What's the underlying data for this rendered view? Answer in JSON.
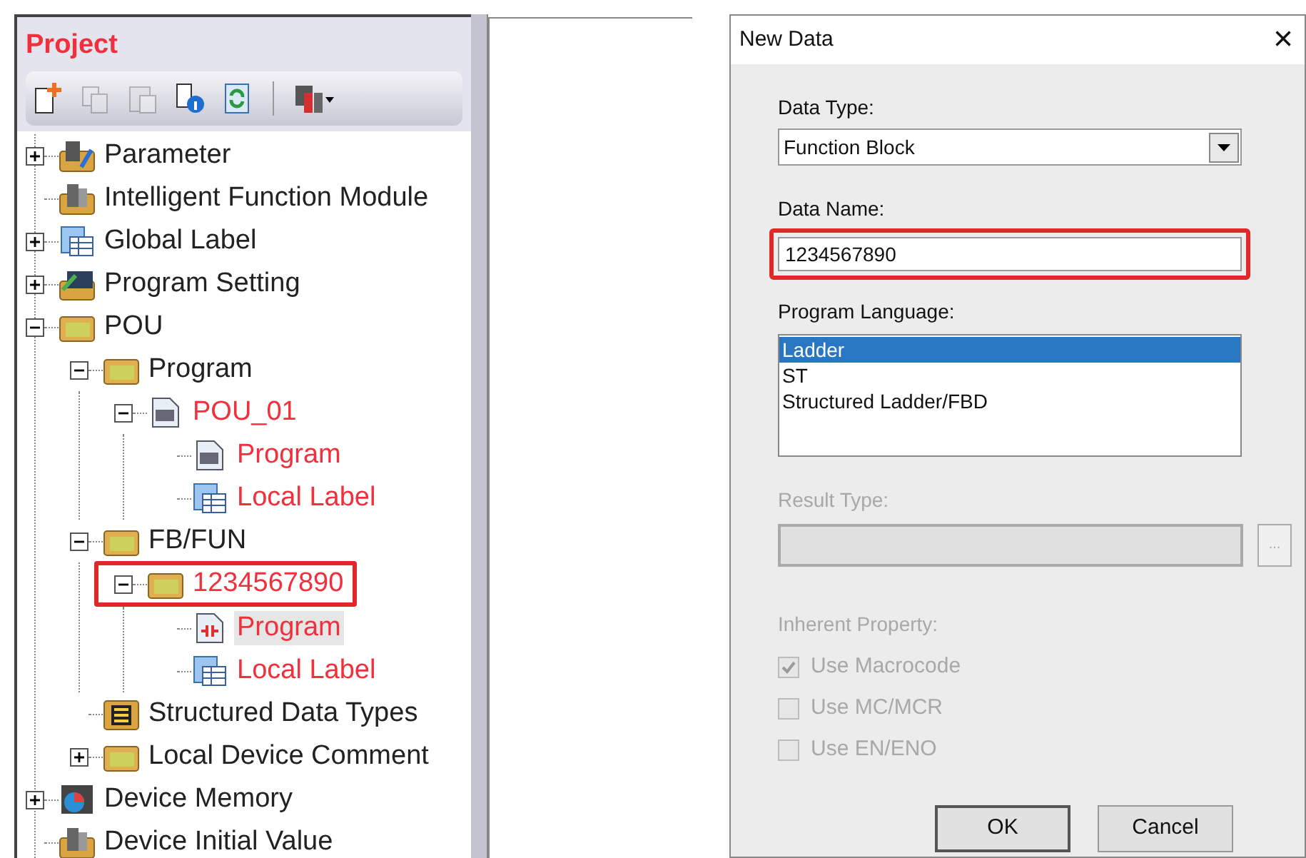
{
  "project_panel": {
    "title": "Project",
    "toolbar": [
      {
        "kind": "new",
        "disabled": false
      },
      {
        "kind": "copy",
        "disabled": true
      },
      {
        "kind": "paste",
        "disabled": true
      },
      {
        "kind": "info",
        "disabled": false
      },
      {
        "kind": "refresh",
        "disabled": false
      },
      {
        "kind": "separator"
      },
      {
        "kind": "device",
        "disabled": false
      }
    ],
    "tree": [
      {
        "label": "Parameter",
        "kind": "gear",
        "expanded": false,
        "modified": false
      },
      {
        "label": "Intelligent Function Module",
        "kind": "module",
        "modified": false
      },
      {
        "label": "Global Label",
        "kind": "table",
        "expanded": false,
        "modified": false
      },
      {
        "label": "Program Setting",
        "kind": "monitor",
        "expanded": false,
        "modified": false
      },
      {
        "label": "POU",
        "kind": "folder",
        "expanded": true,
        "modified": false,
        "children": [
          {
            "label": "Program",
            "kind": "folder",
            "expanded": true,
            "modified": false,
            "children": [
              {
                "label": "POU_01",
                "kind": "document",
                "expanded": true,
                "modified": true,
                "children": [
                  {
                    "label": "Program",
                    "kind": "document",
                    "modified": true,
                    "selected": false
                  },
                  {
                    "label": "Local Label",
                    "kind": "table",
                    "modified": true,
                    "selected": false
                  }
                ]
              }
            ]
          },
          {
            "label": "FB/FUN",
            "kind": "folder",
            "expanded": true,
            "modified": false,
            "children": [
              {
                "label": "1234567890",
                "kind": "folder",
                "expanded": true,
                "modified": true,
                "marked": true,
                "children": [
                  {
                    "label": "Program",
                    "kind": "ladder",
                    "modified": true,
                    "selected": true
                  },
                  {
                    "label": "Local Label",
                    "kind": "table",
                    "modified": true,
                    "selected": false
                  }
                ]
              }
            ]
          },
          {
            "label": "Structured Data Types",
            "kind": "struct",
            "modified": false
          },
          {
            "label": "Local Device Comment",
            "kind": "folder",
            "expanded": false,
            "modified": false
          }
        ]
      },
      {
        "label": "Device Memory",
        "kind": "chart",
        "expanded": false,
        "modified": false
      },
      {
        "label": "Device Initial Value",
        "kind": "module",
        "modified": false
      }
    ]
  },
  "dialog": {
    "title": "New Data",
    "close": "×",
    "data_type": {
      "label": "Data Type:",
      "value": "Function Block"
    },
    "data_name": {
      "label": "Data Name:",
      "value": "1234567890",
      "marked": true
    },
    "program_language": {
      "label": "Program Language:",
      "options": [
        {
          "label": "Ladder",
          "selected": true
        },
        {
          "label": "ST",
          "selected": false
        },
        {
          "label": "Structured Ladder/FBD",
          "selected": false
        }
      ]
    },
    "result_type": {
      "label": "Result Type:",
      "disabled": true,
      "browse": "..."
    },
    "inherent_property": {
      "label": "Inherent Property:",
      "disabled": true,
      "options": [
        {
          "label": "Use Macrocode",
          "checked": true
        },
        {
          "label": "Use MC/MCR",
          "checked": false
        },
        {
          "label": "Use EN/ENO",
          "checked": false
        }
      ]
    },
    "buttons": [
      {
        "label": "OK",
        "default": true
      },
      {
        "label": "Cancel",
        "default": false
      }
    ]
  }
}
